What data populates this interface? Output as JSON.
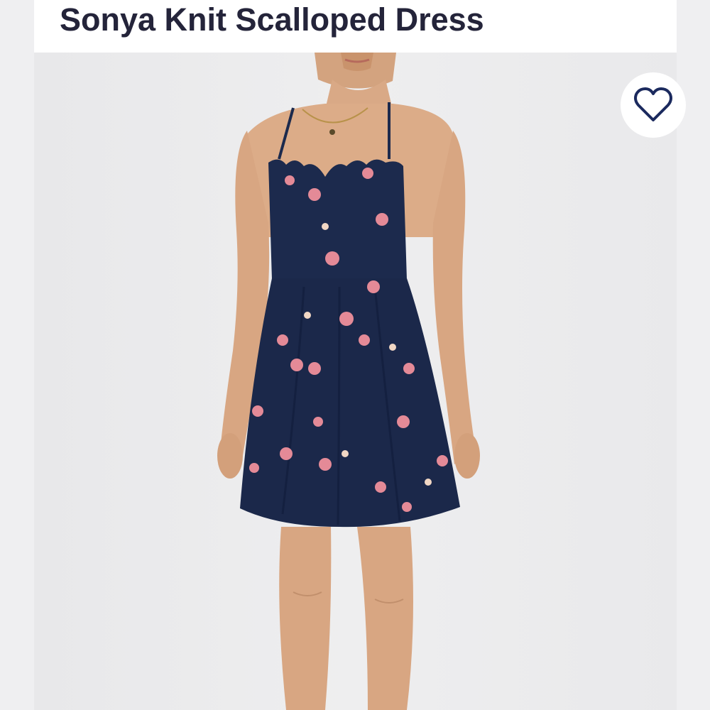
{
  "product": {
    "title": "Sonya Knit Scalloped Dress",
    "image_description_icon": "product-photo"
  },
  "actions": {
    "favorite_icon": "heart-outline-icon"
  },
  "colors": {
    "title_text": "#24243a",
    "heart_outline": "#1b2a5e",
    "dress_navy": "#1c2a4d",
    "flower_pink": "#e48a97",
    "page_background": "#ececee"
  }
}
